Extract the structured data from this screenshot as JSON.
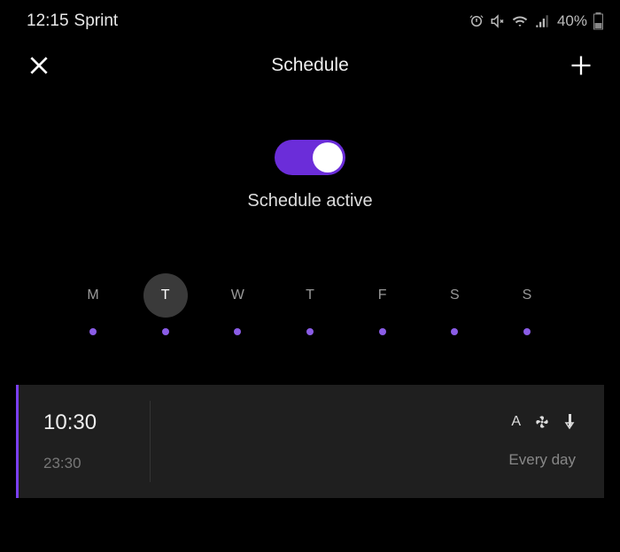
{
  "status": {
    "time": "12:15",
    "carrier": "Sprint",
    "battery_pct": "40%"
  },
  "header": {
    "title": "Schedule"
  },
  "toggle": {
    "label": "Schedule active",
    "on": true
  },
  "days": [
    {
      "label": "M",
      "selected": false,
      "has_event": true
    },
    {
      "label": "T",
      "selected": true,
      "has_event": true
    },
    {
      "label": "W",
      "selected": false,
      "has_event": true
    },
    {
      "label": "T",
      "selected": false,
      "has_event": true
    },
    {
      "label": "F",
      "selected": false,
      "has_event": true
    },
    {
      "label": "S",
      "selected": false,
      "has_event": true
    },
    {
      "label": "S",
      "selected": false,
      "has_event": true
    }
  ],
  "schedule_item": {
    "start": "10:30",
    "end": "23:30",
    "mode_label": "A",
    "frequency": "Every day"
  }
}
